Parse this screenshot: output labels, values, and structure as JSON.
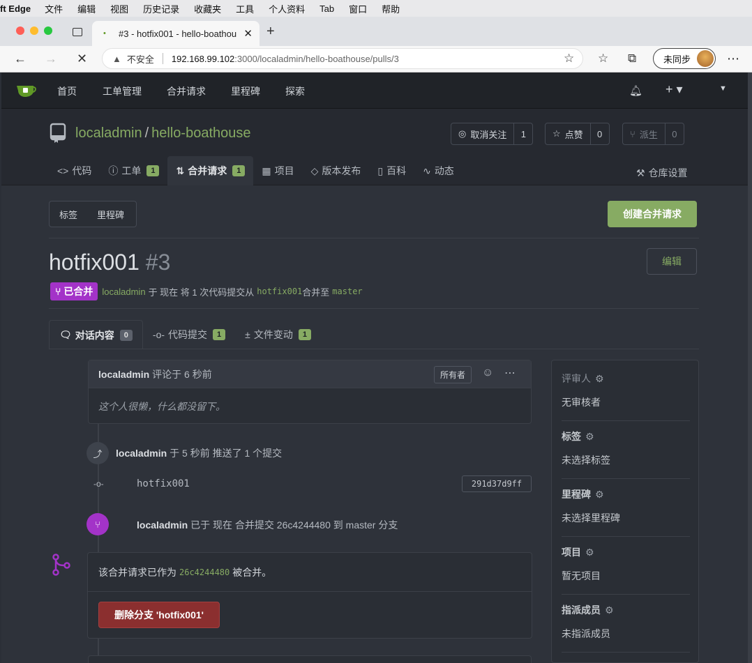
{
  "os_menu": [
    "ft Edge",
    "文件",
    "编辑",
    "视图",
    "历史记录",
    "收藏夹",
    "工具",
    "个人资料",
    "Tab",
    "窗口",
    "帮助"
  ],
  "browser": {
    "tab_title": "#3 - hotfix001 - hello-boathou",
    "security": "不安全",
    "url_host": "192.168.99.102",
    "url_path": ":3000/localadmin/hello-boathouse/pulls/3",
    "sync_label": "未同步"
  },
  "nav": {
    "items": [
      "首页",
      "工单管理",
      "合并请求",
      "里程碑",
      "探索"
    ]
  },
  "repo": {
    "owner": "localadmin",
    "name": "hello-boathouse",
    "watch_label": "取消关注",
    "watch_count": "1",
    "star_label": "点赞",
    "star_count": "0",
    "fork_label": "派生",
    "fork_count": "0",
    "tabs": [
      {
        "label": "代码"
      },
      {
        "label": "工单",
        "count": "1"
      },
      {
        "label": "合并请求",
        "count": "1"
      },
      {
        "label": "项目"
      },
      {
        "label": "版本发布"
      },
      {
        "label": "百科"
      },
      {
        "label": "动态"
      }
    ],
    "settings_label": "仓库设置"
  },
  "toolbar": {
    "labels": "标签",
    "milestones": "里程碑",
    "create_pr": "创建合并请求"
  },
  "pr": {
    "title": "hotfix001",
    "number": "#3",
    "edit": "编辑",
    "status": "已合并",
    "meta_user": "localadmin",
    "meta_text1": "于 现在 将 1 次代码提交从",
    "meta_from": "hotfix001",
    "meta_text2": "合并至",
    "meta_to": "master",
    "tabs": [
      {
        "label": "对话内容",
        "count": "0"
      },
      {
        "label": "代码提交",
        "count": "1"
      },
      {
        "label": "文件变动",
        "count": "1"
      }
    ]
  },
  "comment": {
    "author": "localadmin",
    "time": "评论于 6 秒前",
    "role": "所有者",
    "body": "这个人很懒，什么都没留下。"
  },
  "events": {
    "push_user": "localadmin",
    "push_text": "于 5 秒前 推送了 1 个提交",
    "commit_branch": "hotfix001",
    "commit_sha": "291d37d9ff",
    "merge_user": "localadmin",
    "merge_text": "已于 现在 合并提交 26c4244480 到 master 分支"
  },
  "merge_box": {
    "text1": "该合并请求已作为",
    "sha": "26c4244480",
    "text2": "被合并。",
    "delete_btn": "删除分支 'hotfix001'"
  },
  "sidebar": {
    "reviewers_title": "评审人",
    "reviewers_value": "无审核者",
    "labels_title": "标签",
    "labels_value": "未选择标签",
    "milestone_title": "里程碑",
    "milestone_value": "未选择里程碑",
    "projects_title": "项目",
    "projects_value": "暂无项目",
    "assignees_title": "指派成员",
    "assignees_value": "未指派成员"
  },
  "colors": {
    "accent": "#87ab63",
    "merged": "#a333c8",
    "danger": "#8b2f2f"
  }
}
